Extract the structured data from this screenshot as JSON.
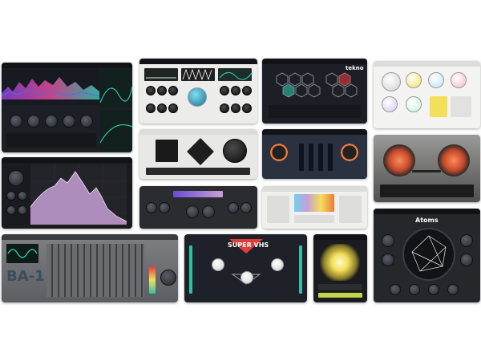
{
  "collage": {
    "plugins": [
      {
        "id": "spectral",
        "name": ""
      },
      {
        "id": "modular",
        "name": ""
      },
      {
        "id": "tekno",
        "name": "tekno"
      },
      {
        "id": "light-grid",
        "name": ""
      },
      {
        "id": "drum-machine",
        "name": ""
      },
      {
        "id": "compressor",
        "name": ""
      },
      {
        "id": "tape-reels",
        "name": ""
      },
      {
        "id": "filter-curve",
        "name": ""
      },
      {
        "id": "compact-synth",
        "name": ""
      },
      {
        "id": "color-pad",
        "name": ""
      },
      {
        "id": "ba1",
        "name": "BA-1"
      },
      {
        "id": "super-vhs",
        "name": "SUPER VHS"
      },
      {
        "id": "orb",
        "name": ""
      },
      {
        "id": "atoms",
        "name": "Atoms"
      }
    ]
  },
  "colors": {
    "accent_purple": "#c79fd6",
    "accent_orange": "#f07a3b",
    "accent_teal": "#2fc1a7",
    "accent_yellow": "#f3df5a",
    "accent_red": "#e23b3b"
  }
}
